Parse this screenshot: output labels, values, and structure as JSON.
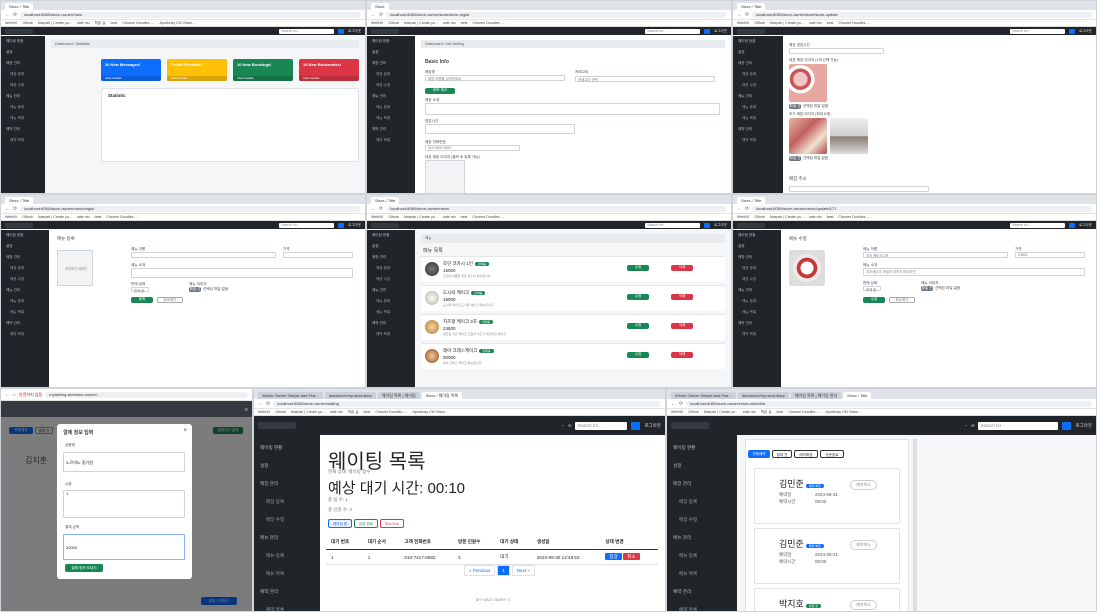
{
  "common": {
    "brand": "Admin",
    "search_placeholder": "Search for...",
    "user_label": "로그아웃",
    "bookmarks": [
      "WebNX",
      "Github",
      "Naepsh | Create yo...",
      "cafe ntu",
      "학습 실",
      "best",
      "Chrome Doodles -...",
      "Apollonsy CM Vitam..."
    ]
  },
  "p1": {
    "tab": "Sixxx / Title",
    "url": "localhost:8080/store-owner/main",
    "crumb": "Dashboard / Statistics",
    "cards": [
      {
        "label": "26 New Messages!",
        "color": "#0d6efd"
      },
      {
        "label": "Online Reviews!",
        "color": "#ffc107"
      },
      {
        "label": "10 New Bookings!",
        "color": "#198754"
      },
      {
        "label": "13 New Bookmarks!",
        "color": "#dc3545"
      }
    ],
    "card_footer": "View Details",
    "stat_title": "Statistic"
  },
  "p2": {
    "tab": "Sixxx",
    "url": "localhost:8080/store-owner/store/store-regist",
    "crumb": "Dashboard / Info Setting",
    "title": "Basic Info",
    "fields": [
      "매장명",
      "카테고리",
      "매장 소개",
      "영업시간",
      "매장 전화번호",
      "대표 매장 이미지 (클릭 후 등록 가능)"
    ],
    "store_name": "매장 이름을 입력하세요",
    "category": "카테고리 선택",
    "phone": "010-0000-0000",
    "submit": "중복 체크"
  },
  "p3": {
    "tab": "Sixxx / Title",
    "url": "localhost:8080/store-owner/store/store-update",
    "fields": [
      "매장 영업시간",
      "대표 매장 이미지 (1개 선택 가능)",
      "추가 매장 이미지 (최대 5개)"
    ],
    "addr_title": "매장 주소",
    "file_btn": "파일 선택",
    "file_none": "선택된 파일 없음"
  },
  "p4": {
    "tab": "Sixxx / Title",
    "url": "localhost:8080/store-owner/menu/regist",
    "title": "메뉴 등록",
    "img_ph": "미리보기 이미지",
    "labels": [
      "메뉴 이름",
      "가격",
      "메뉴 소개",
      "판매 상태",
      "메뉴 이미지"
    ],
    "state": "판매 중",
    "file_btn": "파일 선택",
    "file_none": "선택된 파일 없음",
    "submit": "등록",
    "cancel": "취소하기"
  },
  "p5": {
    "tab": "Sixxx / Title",
    "url": "localhost:8080/store-owner/menu",
    "crumb": "메뉴",
    "title": "메뉴 목록",
    "items": [
      {
        "name": "조던 코카시 1인",
        "price": "15000",
        "desc": "조던의 이름을 담은 파스타 메뉴입니다"
      },
      {
        "name": "도시락 케이크",
        "price": "15000",
        "desc": "도시락 케이크 도시락 케이크 메뉴입니다"
      },
      {
        "name": "치즈펑 케이크 2조",
        "price": "24500",
        "desc": "생크림 치즈 케이크 크림과 치즈가 어우러진 케이크"
      },
      {
        "name": "레어 크레스케이크",
        "price": "30000",
        "desc": "레어 크레스 케이크 메뉴입니다"
      }
    ],
    "badge": "판매중",
    "edit": "수정",
    "del": "삭제"
  },
  "p6": {
    "tab": "Sixxx / Title",
    "url": "localhost:8080/store-owner/menu/update/177",
    "title": "메뉴 수정",
    "labels": [
      "메뉴 이름",
      "가격",
      "메뉴 소개",
      "판매 상태",
      "메뉴 이미지"
    ],
    "name": "치즈 케이크 2조",
    "price": "24500",
    "desc": "치즈케이크 크림과 치즈가 어우러진",
    "state": "판매 중",
    "file_btn": "파일 선택",
    "file_none": "선택된 파일 없음",
    "submit": "수정",
    "cancel": "취소하기"
  },
  "p7": {
    "url": "mytabling.site/store-owner/...",
    "url_prefix": "안전하지 않음",
    "modal_title": "결제 정보 입력",
    "lbl1": "상품명",
    "val1": "노르마노 중기원",
    "lbl2": "수량",
    "val2": "1",
    "lbl3": "결제 금액",
    "val3": "20000",
    "submit": "결제 정보 보내기",
    "bg_btns": [
      "전체예약",
      "결제 전"
    ],
    "bg_green": "결제대기 결제",
    "bg_name": "김지훈",
    "bg_blue": "결제 시작하기"
  },
  "p8": {
    "tabs": [
      "Whole Owner Simple and Fea...",
      "donatorch/my-seat-diary",
      "웨이팅 목록 | 웨이팅",
      "Sixxx / 웨이팅 목록"
    ],
    "url": "localhost:8080/store-owner/waiting",
    "sidebar": [
      {
        "label": "웨이팅 현황",
        "sub": false
      },
      {
        "label": "설정",
        "sub": false
      },
      {
        "label": "매장 관리",
        "sub": false
      },
      {
        "label": "매장 등록",
        "sub": true
      },
      {
        "label": "매장 수정",
        "sub": true
      },
      {
        "label": "메뉴 관리",
        "sub": false
      },
      {
        "label": "메뉴 등록",
        "sub": true
      },
      {
        "label": "메뉴 목록",
        "sub": true
      },
      {
        "label": "예약 관리",
        "sub": false
      },
      {
        "label": "예약 목록",
        "sub": true
      }
    ],
    "title": "웨이팅 목록",
    "subtitle": "현재 상태: 웨이팅 접수",
    "wait_time": "예상 대기 시간: 00:10",
    "count1": "총 팀 수: 1",
    "count2": "총 인원 수: 3",
    "filters": [
      "웨이팅 중",
      "입장 완료",
      "취소/노쇼"
    ],
    "table_headers": [
      "대기 번호",
      "대기 순서",
      "고객 전화번호",
      "방문 인원수",
      "대기 상태",
      "생성일",
      "상태 변경"
    ],
    "rows": [
      {
        "no": "1",
        "order": "1",
        "phone": "010-7417-0582",
        "people": "3",
        "state": "대기",
        "created": "2024-09-30 12:48:52"
      }
    ],
    "btn_enter": "입장",
    "btn_cancel": "취소",
    "pager": [
      "« Previous",
      "1",
      "Next »"
    ],
    "footer": "MY SEAT DIARY ©"
  },
  "p9": {
    "tabs": [
      "Whole Owner Simple and Fea...",
      "donatorch/my-seat-diary",
      "웨이팅 목록 | 웨이팅 관리",
      "Sixxx / Title"
    ],
    "url": "localhost:8080/store-owner/reservation/list",
    "sidebar": [
      {
        "label": "웨이팅 현황",
        "sub": false
      },
      {
        "label": "설정",
        "sub": false
      },
      {
        "label": "매장 관리",
        "sub": false
      },
      {
        "label": "매장 등록",
        "sub": true
      },
      {
        "label": "매장 수정",
        "sub": true
      },
      {
        "label": "메뉴 관리",
        "sub": false
      },
      {
        "label": "메뉴 등록",
        "sub": true
      },
      {
        "label": "메뉴 목록",
        "sub": true
      },
      {
        "label": "예약 관리",
        "sub": false
      },
      {
        "label": "예약 목록",
        "sub": true
      }
    ],
    "filters": [
      "전체예약",
      "결제 전",
      "예약확정",
      "방문완료"
    ],
    "cards": [
      {
        "name": "김민준",
        "badge": "예약 확정",
        "keys": [
          "예약일",
          "예약시간"
        ],
        "date": "2024-08-31",
        "time": "09:00"
      },
      {
        "name": "김민준",
        "badge": "예약 확정",
        "keys": [
          "예약일",
          "예약시간"
        ],
        "date": "2024-08-31",
        "time": "09:00"
      },
      {
        "name": "박지호",
        "badge": "방문 완",
        "keys": [],
        "date": "",
        "time": ""
      }
    ],
    "cancel_btn": "예약취소"
  }
}
